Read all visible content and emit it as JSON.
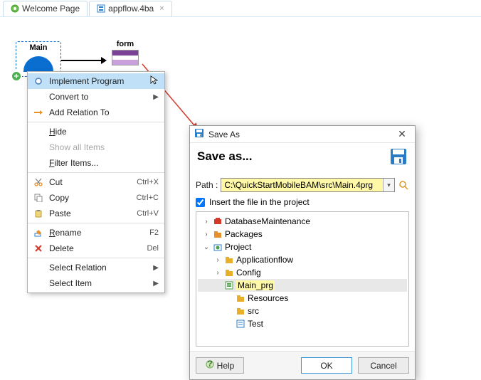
{
  "tabs": {
    "welcome": "Welcome Page",
    "appflow": "appflow.4ba"
  },
  "canvas": {
    "main_label": "Main",
    "form_label": "form"
  },
  "ctx": {
    "implement": "Implement Program",
    "convert": "Convert to",
    "addrel": "Add Relation To",
    "hide": "Hide",
    "hide_mn": "H",
    "showall": "Show all Items",
    "filter": "Filter Items...",
    "filter_mn": "F",
    "cut": "Cut",
    "cut_kb": "Ctrl+X",
    "copy": "Copy",
    "copy_kb": "Ctrl+C",
    "paste": "Paste",
    "paste_kb": "Ctrl+V",
    "rename": "Rename",
    "rename_kb": "F2",
    "rename_mn": "R",
    "delete": "Delete",
    "delete_kb": "Del",
    "selrel": "Select Relation",
    "selitem": "Select Item"
  },
  "dialog": {
    "title": "Save As",
    "heading": "Save as...",
    "path_label": "Path :",
    "path_value": "C:\\QuickStartMobileBAM\\src\\Main.4prg",
    "insert_label": "Insert the file in the project",
    "help": "Help",
    "ok": "OK",
    "cancel": "Cancel",
    "tree": {
      "dbmaint": "DatabaseMaintenance",
      "packages": "Packages",
      "project": "Project",
      "appflow": "Applicationflow",
      "config": "Config",
      "mainprg": "Main_prg",
      "resources": "Resources",
      "src": "src",
      "test": "Test"
    }
  }
}
